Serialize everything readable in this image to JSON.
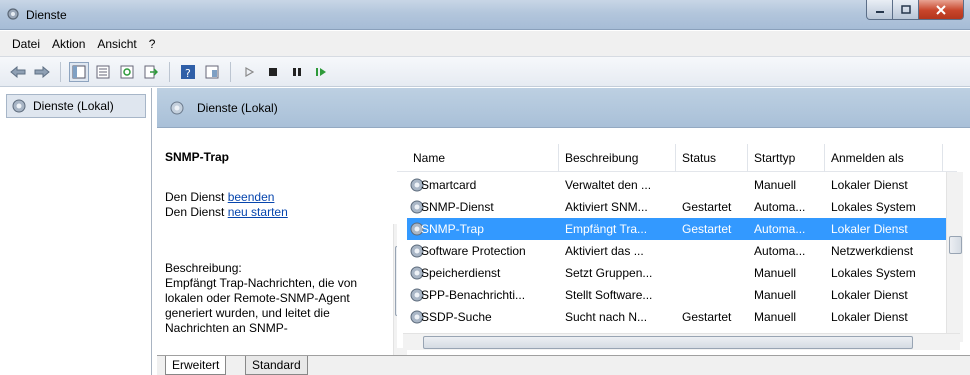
{
  "window": {
    "title": "Dienste"
  },
  "menu": [
    "Datei",
    "Aktion",
    "Ansicht",
    "?"
  ],
  "tree": {
    "root_label": "Dienste (Lokal)"
  },
  "main": {
    "header_label": "Dienste (Lokal)",
    "selected_service": "SNMP-Trap",
    "action1_prefix": "Den Dienst ",
    "action1_link": "beenden",
    "action2_prefix": "Den Dienst ",
    "action2_link": "neu starten",
    "description_label": "Beschreibung:",
    "description_text": "Empfängt Trap-Nachrichten, die von lokalen oder Remote-SNMP-Agent generiert wurden, und leitet die Nachrichten an SNMP-"
  },
  "list": {
    "columns": [
      "Name",
      "Beschreibung",
      "Status",
      "Starttyp",
      "Anmelden als"
    ],
    "rows": [
      {
        "name": "Smartcard",
        "desc": "Verwaltet den ...",
        "status": "",
        "start": "Manuell",
        "logon": "Lokaler Dienst"
      },
      {
        "name": "SNMP-Dienst",
        "desc": "Aktiviert SNM...",
        "status": "Gestartet",
        "start": "Automa...",
        "logon": "Lokales System"
      },
      {
        "name": "SNMP-Trap",
        "desc": "Empfängt Tra...",
        "status": "Gestartet",
        "start": "Automa...",
        "logon": "Lokaler Dienst"
      },
      {
        "name": "Software Protection",
        "desc": "Aktiviert das ...",
        "status": "",
        "start": "Automa...",
        "logon": "Netzwerkdienst"
      },
      {
        "name": "Speicherdienst",
        "desc": "Setzt Gruppen...",
        "status": "",
        "start": "Manuell",
        "logon": "Lokales System"
      },
      {
        "name": "SPP-Benachrichti...",
        "desc": "Stellt Software...",
        "status": "",
        "start": "Manuell",
        "logon": "Lokaler Dienst"
      },
      {
        "name": "SSDP-Suche",
        "desc": "Sucht nach N...",
        "status": "Gestartet",
        "start": "Manuell",
        "logon": "Lokaler Dienst"
      }
    ],
    "selected_index": 2
  },
  "tabs": [
    "Erweitert",
    "Standard"
  ],
  "colors": {
    "selection": "#3399ff",
    "link": "#0645ad",
    "header_bg": "#b3c6dc"
  }
}
